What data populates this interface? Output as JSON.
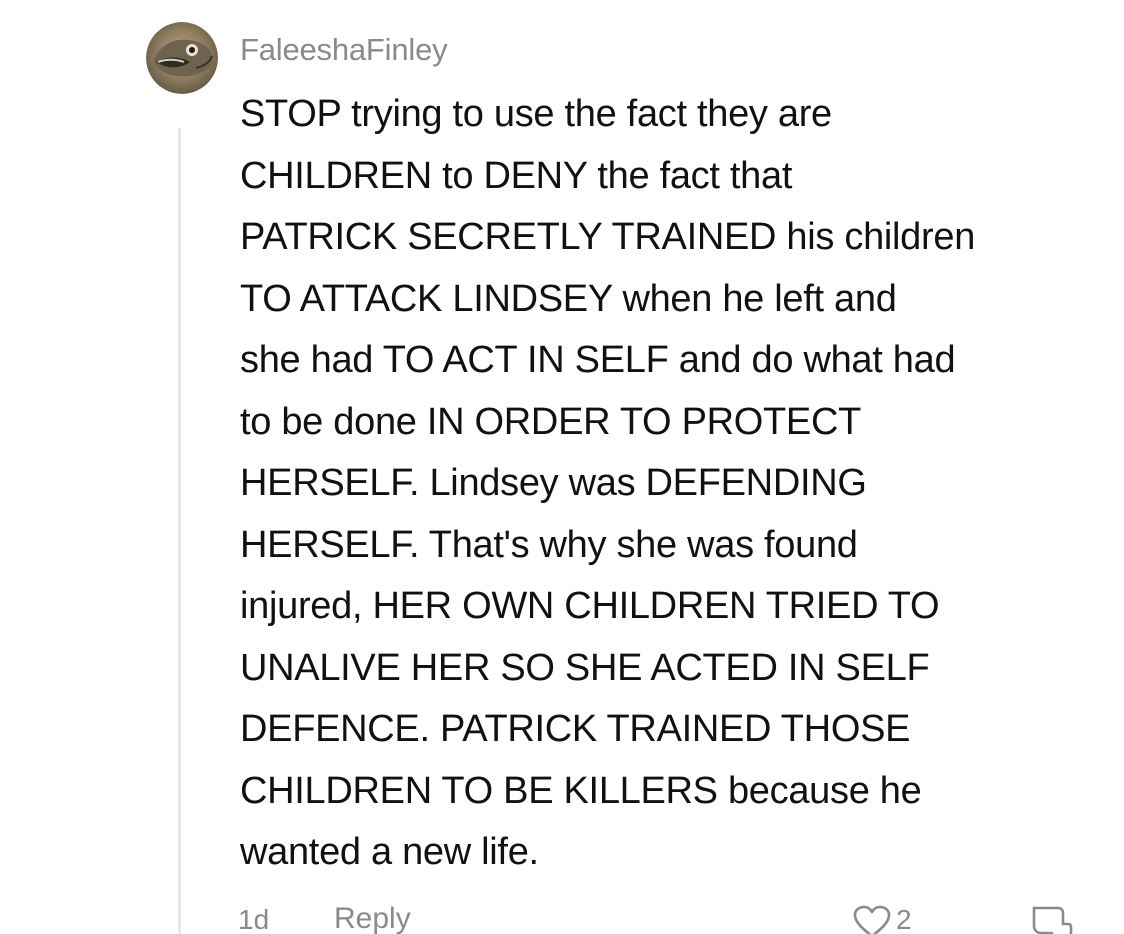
{
  "comment": {
    "username": "FaleeshaFinley",
    "lines": [
      "STOP trying to use the fact they are",
      "CHILDREN to DENY the fact that",
      "PATRICK SECRETLY TRAINED his children",
      "TO ATTACK LINDSEY when he left and",
      "she had TO ACT IN SELF and do what had",
      "to be done IN ORDER TO PROTECT",
      "HERSELF. Lindsey was DEFENDING",
      "HERSELF. That's why she was found",
      "injured, HER OWN CHILDREN TRIED TO",
      "UNALIVE HER SO SHE ACTED IN SELF",
      "DEFENCE. PATRICK TRAINED THOSE",
      "CHILDREN TO BE KILLERS because he",
      "wanted a new life."
    ],
    "timestamp": "1d",
    "reply_label": "Reply",
    "like_count": "2",
    "icons": {
      "avatar": "fish-avatar",
      "like": "heart-outline-icon",
      "dislike": "thumbs-down-outline-icon"
    }
  },
  "colors": {
    "text_primary": "#111111",
    "text_secondary": "#8a8a8a",
    "thread_line": "#e6e6e6",
    "background": "#ffffff"
  }
}
